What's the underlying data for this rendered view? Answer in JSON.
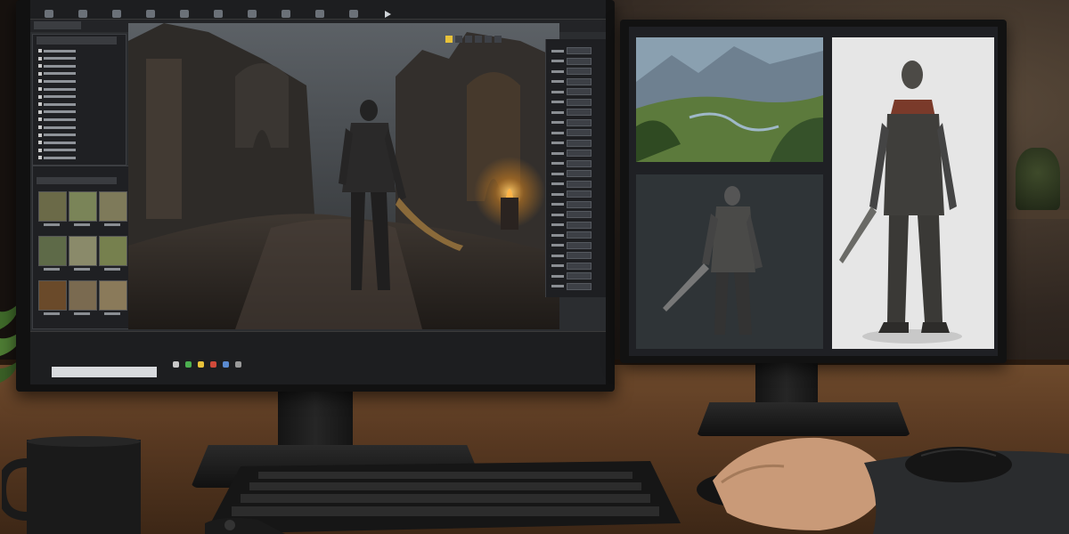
{
  "scene": {
    "description_colors": {
      "wall": "#2f2620",
      "desk_wood": "#5a3a22",
      "monitor_frame": "#111111",
      "editor_bg": "#2b2d30",
      "torch_glow": "#f0a030",
      "accent_yellow": "#e8c23a"
    }
  },
  "left_monitor": {
    "icons": [
      "toolbar-icon",
      "play-icon",
      "folder-icon",
      "search-icon"
    ]
  },
  "right_monitor": {
    "images": [
      "landscape-concept-art",
      "knight-dark-render",
      "knight-clay-render"
    ]
  }
}
